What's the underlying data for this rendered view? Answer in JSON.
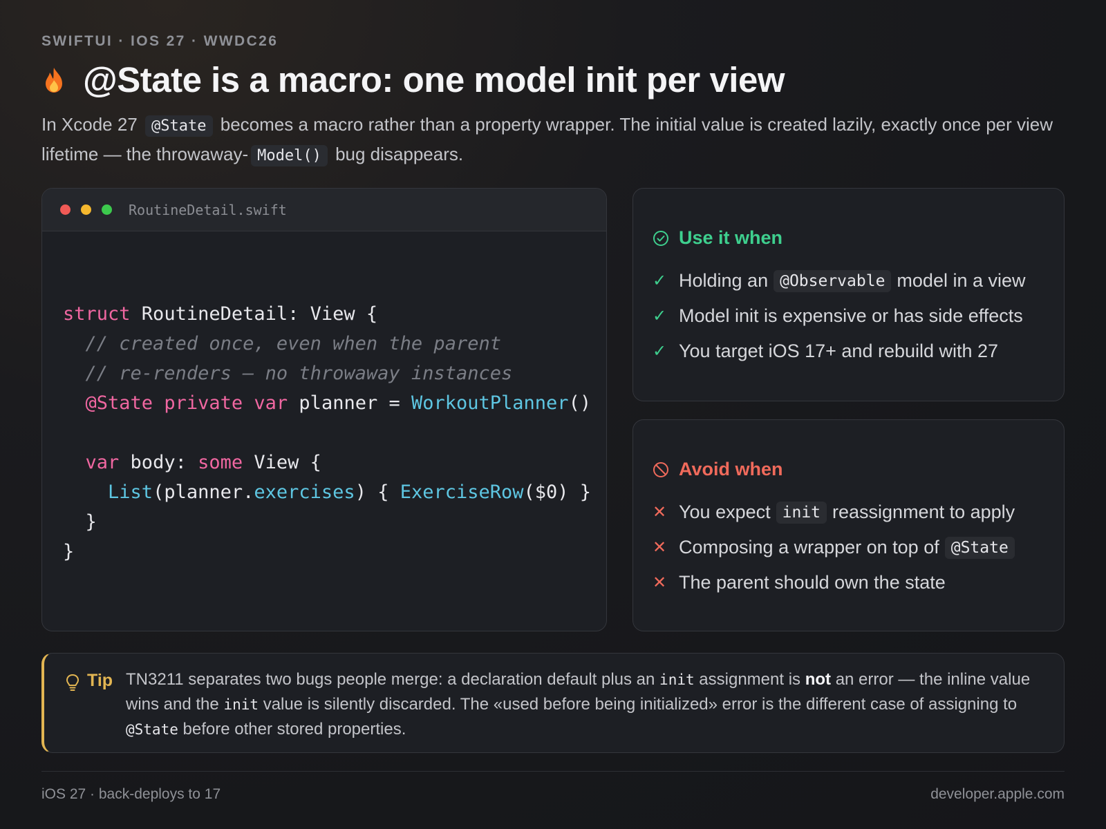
{
  "eyebrow": "SWIFTUI · IOS 27 · WWDC26",
  "title": "@State is a macro: one model init per view",
  "intro": {
    "p1": "In Xcode 27",
    "code1": "@State",
    "p2": "becomes a macro rather than a property wrapper. The initial value is created lazily, exactly once per view lifetime — the throwaway-",
    "code2": "Model()",
    "p3": "bug disappears."
  },
  "code_card": {
    "filename": "RoutineDetail.swift",
    "lines": [
      "struct RoutineDetail: View {",
      "  // created once, even when the parent",
      "  // re-renders — no throwaway instances",
      "  @State private var planner = WorkoutPlanner()",
      "",
      "  var body: some View {",
      "    List(planner.exercises) { ExerciseRow($0) }",
      "  }",
      "}"
    ]
  },
  "use_card": {
    "heading": "Use it when",
    "icon": "check-circle-icon",
    "items": [
      {
        "pre": "Holding an",
        "code": "@Observable",
        "post": "model in a view"
      },
      {
        "pre": "Model init is expensive or has side effects",
        "code": "",
        "post": ""
      },
      {
        "pre": "You target iOS 17+ and rebuild with 27",
        "code": "",
        "post": ""
      }
    ]
  },
  "avoid_card": {
    "heading": "Avoid when",
    "icon": "prohibited-icon",
    "items": [
      {
        "pre": "You expect",
        "code": "init",
        "post": "reassignment to apply"
      },
      {
        "pre": "Composing a wrapper on top of",
        "code": "@State",
        "post": ""
      },
      {
        "pre": "The parent should own the state",
        "code": "",
        "post": ""
      }
    ]
  },
  "tip": {
    "label": "Tip",
    "t1": "TN3211 separates two bugs people merge: a declaration default plus an",
    "c1": "init",
    "t2": "assignment is",
    "bold": "not",
    "t3": "an error — the inline value wins and the",
    "c2": "init",
    "t4": "value is silently discarded. The «used before being initialized» error is the different case of assigning to",
    "c3": "@State",
    "t5": "before other stored properties."
  },
  "footer": {
    "left": "iOS 27 · back-deploys to 17",
    "right": "developer.apple.com"
  },
  "colors": {
    "accent_green": "#3ecf8e",
    "accent_red": "#f06a5b",
    "accent_yellow": "#e2b552",
    "keyword_pink": "#f067a1",
    "type_cyan": "#5ec6e2"
  }
}
